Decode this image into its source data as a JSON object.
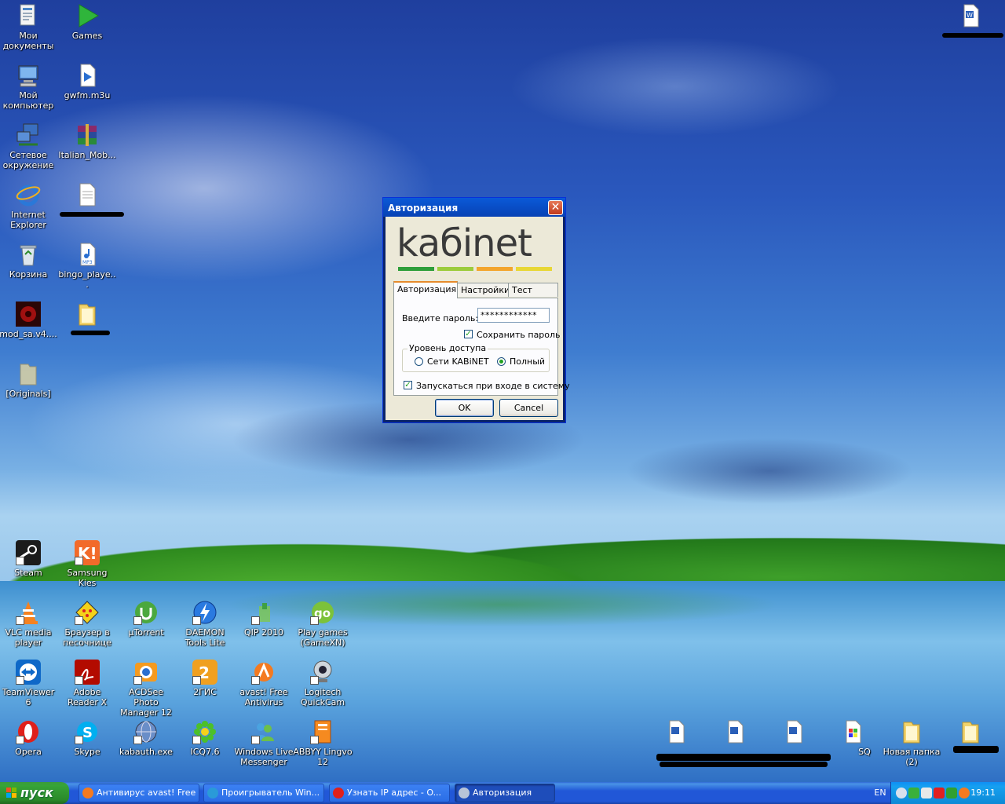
{
  "desktop": {
    "icons_left": [
      {
        "label": "Мои документы",
        "icon": "my-documents-icon"
      },
      {
        "label": "Games",
        "icon": "games-arrow-icon"
      },
      {
        "label": "Мой компьютер",
        "icon": "my-computer-icon"
      },
      {
        "label": "gwfm.m3u",
        "icon": "playlist-file-icon"
      },
      {
        "label": "Сетевое окружение",
        "icon": "network-icon"
      },
      {
        "label": "Italian_Mob...",
        "icon": "winrar-archive-icon"
      },
      {
        "label": "Internet Explorer",
        "icon": "internet-explorer-icon"
      },
      {
        "label": "",
        "icon": "text-file-icon"
      },
      {
        "label": "Корзина",
        "icon": "recycle-bin-icon"
      },
      {
        "label": "bingo_playe...",
        "icon": "mp3-file-icon"
      },
      {
        "label": "mod_sa.v4....",
        "icon": "mod-sa-icon"
      },
      {
        "label": "",
        "icon": "folder-icon"
      },
      {
        "label": "[Originals]",
        "icon": "folder-icon"
      }
    ],
    "icons_bottom": [
      {
        "label": "Steam",
        "icon": "steam-icon"
      },
      {
        "label": "Samsung Kies",
        "icon": "samsung-kies-icon"
      },
      {
        "label": "VLC media player",
        "icon": "vlc-icon"
      },
      {
        "label": "Браузер в песочнице",
        "icon": "sandbox-browser-icon"
      },
      {
        "label": "µTorrent",
        "icon": "utorrent-icon"
      },
      {
        "label": "DAEMON Tools Lite",
        "icon": "daemon-tools-icon"
      },
      {
        "label": "QIP 2010",
        "icon": "qip-icon"
      },
      {
        "label": "Play games (GameXN)",
        "icon": "gamexn-icon"
      },
      {
        "label": "TeamViewer 6",
        "icon": "teamviewer-icon"
      },
      {
        "label": "Adobe Reader X",
        "icon": "adobe-reader-icon"
      },
      {
        "label": "ACDSee Photo Manager 12",
        "icon": "acdsee-icon"
      },
      {
        "label": "2ГИС",
        "icon": "2gis-icon"
      },
      {
        "label": "avast! Free Antivirus",
        "icon": "avast-icon"
      },
      {
        "label": "Logitech QuickCam",
        "icon": "webcam-icon"
      },
      {
        "label": "Opera",
        "icon": "opera-icon"
      },
      {
        "label": "Skype",
        "icon": "skype-icon"
      },
      {
        "label": "kabauth.exe",
        "icon": "globe-exe-icon"
      },
      {
        "label": "ICQ7.6",
        "icon": "icq-icon"
      },
      {
        "label": "Windows Live Messenger",
        "icon": "messenger-icon"
      },
      {
        "label": "ABBYY Lingvo 12",
        "icon": "lingvo-icon"
      }
    ],
    "icons_right": [
      {
        "label": "SQ",
        "icon": "image-file-icon"
      },
      {
        "label": "Новая папка (2)",
        "icon": "folder-icon"
      }
    ]
  },
  "dialog": {
    "title": "Авторизация",
    "logo_text": "kабinet",
    "tabs": [
      "Авторизация",
      "Настройки",
      "Тест сети"
    ],
    "password_label": "Введите пароль:",
    "password_value": "************",
    "save_password_label": "Сохранить пароль",
    "save_password_checked": true,
    "access_group_title": "Уровень доступа",
    "access_options": [
      "Сети KABiNET",
      "Полный"
    ],
    "access_selected": "Полный",
    "autostart_label": "Запускаться при входе в систему",
    "autostart_checked": true,
    "ok_label": "OK",
    "cancel_label": "Cancel"
  },
  "taskbar": {
    "start_label": "пуск",
    "tasks": [
      {
        "label": "Антивирус avast! Free",
        "icon": "avast-task-icon"
      },
      {
        "label": "Проигрыватель Win...",
        "icon": "media-player-task-icon"
      },
      {
        "label": "Узнать IP адрес - O...",
        "icon": "opera-task-icon"
      },
      {
        "label": "Авторизация",
        "icon": "kabinet-task-icon"
      }
    ],
    "language": "EN",
    "clock": "19:11"
  },
  "colors": {
    "xp_blue": "#0a5ad8",
    "logo_green": "#2e9e3a",
    "logo_lightgreen": "#9ccc3c",
    "logo_orange": "#f3a52d",
    "logo_yellow": "#e8d735"
  }
}
